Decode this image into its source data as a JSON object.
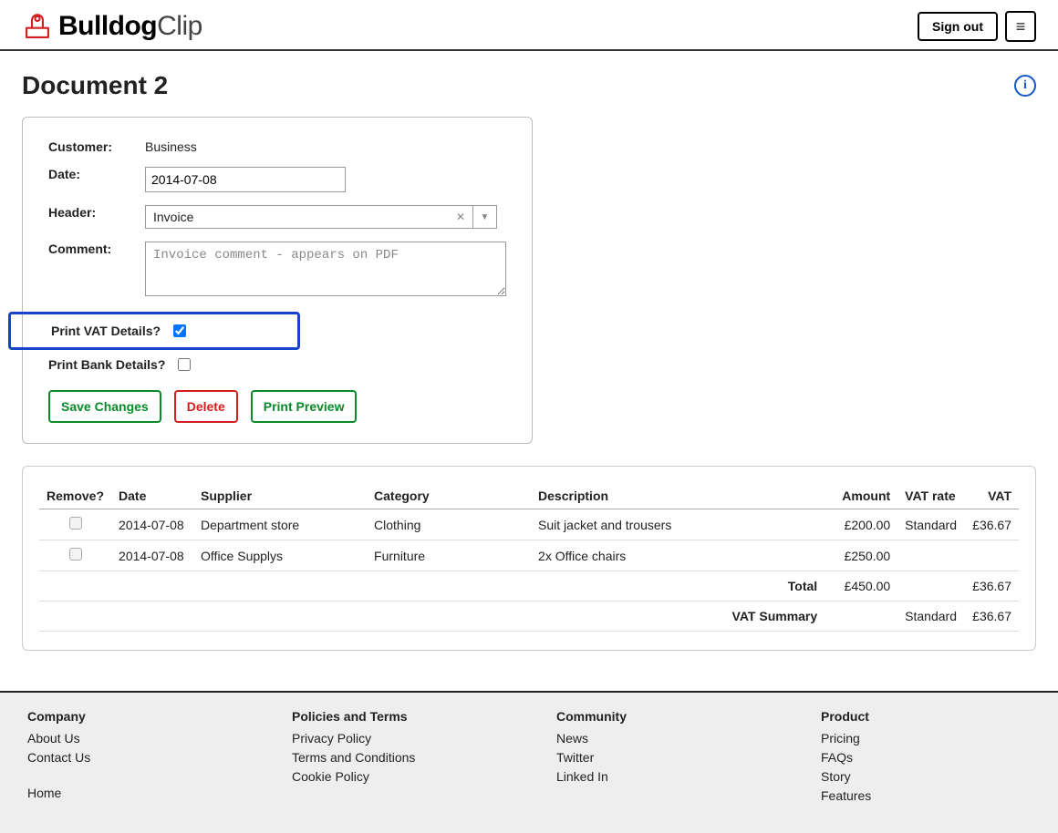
{
  "brand": {
    "bold": "Bulldog",
    "light": "Clip"
  },
  "topbar": {
    "signout": "Sign out"
  },
  "page": {
    "title": "Document 2"
  },
  "form": {
    "customer_label": "Customer:",
    "customer_value": "Business",
    "date_label": "Date:",
    "date_value": "2014-07-08",
    "header_label": "Header:",
    "header_value": "Invoice",
    "comment_label": "Comment:",
    "comment_placeholder": "Invoice comment - appears on PDF",
    "print_vat_label": "Print VAT Details?",
    "print_bank_label": "Print Bank Details?",
    "save": "Save Changes",
    "delete": "Delete",
    "preview": "Print Preview"
  },
  "table": {
    "headers": {
      "remove": "Remove?",
      "date": "Date",
      "supplier": "Supplier",
      "category": "Category",
      "description": "Description",
      "amount": "Amount",
      "vat_rate": "VAT rate",
      "vat": "VAT"
    },
    "rows": [
      {
        "date": "2014-07-08",
        "supplier": "Department store",
        "category": "Clothing",
        "description": "Suit jacket and trousers",
        "amount": "£200.00",
        "vat_rate": "Standard",
        "vat": "£36.67"
      },
      {
        "date": "2014-07-08",
        "supplier": "Office Supplys",
        "category": "Furniture",
        "description": "2x Office chairs",
        "amount": "£250.00",
        "vat_rate": "",
        "vat": ""
      }
    ],
    "total_label": "Total",
    "total_amount": "£450.00",
    "total_vat": "£36.67",
    "summary_label": "VAT Summary",
    "summary_rate": "Standard",
    "summary_vat": "£36.67"
  },
  "footer": {
    "company": {
      "title": "Company",
      "about": "About Us",
      "contact": "Contact Us",
      "home": "Home"
    },
    "policies": {
      "title": "Policies and Terms",
      "privacy": "Privacy Policy",
      "terms": "Terms and Conditions",
      "cookie": "Cookie Policy"
    },
    "community": {
      "title": "Community",
      "news": "News",
      "twitter": "Twitter",
      "linkedin": "Linked In"
    },
    "product": {
      "title": "Product",
      "pricing": "Pricing",
      "faqs": "FAQs",
      "story": "Story",
      "features": "Features"
    }
  }
}
